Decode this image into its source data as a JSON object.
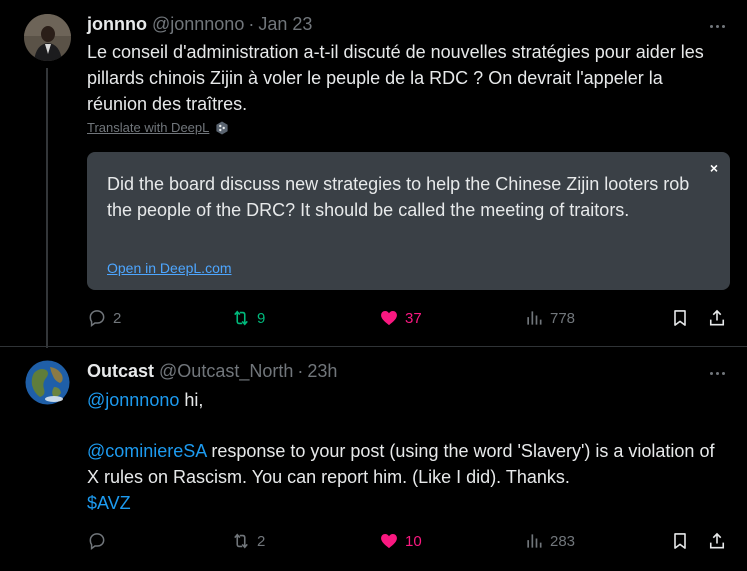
{
  "post1": {
    "name": "jonnno",
    "handle": "@jonnnono",
    "separator": "·",
    "time": "Jan 23",
    "text": "Le conseil d'administration a-t-il discuté de nouvelles stratégies pour aider les pillards chinois Zijin à voler le peuple de la RDC ? On devrait l'appeler la réunion des traîtres.",
    "translate_label": "Translate with DeepL",
    "translation": {
      "text": "Did the board discuss new strategies to help the Chinese Zijin looters rob the people of the DRC? It should be called the meeting of traitors.",
      "link": "Open in DeepL.com",
      "close": "×"
    },
    "actions": {
      "replies": "2",
      "reposts": "9",
      "likes": "37",
      "views": "778"
    }
  },
  "post2": {
    "name": "Outcast",
    "handle": "@Outcast_North",
    "separator": "·",
    "time": "23h",
    "line1_mention": "@jonnnono",
    "line1_rest": " hi,",
    "line2_mention": "@cominiereSA",
    "line2_rest": " response to your post (using the word 'Slavery') is a violation of X rules on Rascism. You can report him. (Like I did). Thanks.",
    "cashtag": "$AVZ",
    "actions": {
      "reposts": "2",
      "likes": "10",
      "views": "283"
    }
  },
  "colors": {
    "background": "#000000",
    "accent_blue": "#1d9bf0",
    "repost_green": "#00ba7c",
    "like_pink": "#f91880",
    "muted": "#71767b"
  }
}
